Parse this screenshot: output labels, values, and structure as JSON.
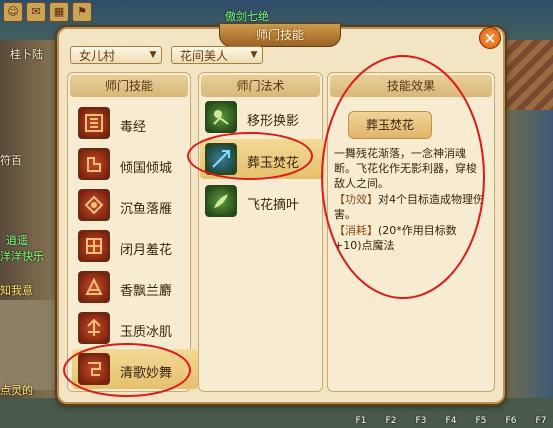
{
  "window": {
    "title": "师门技能",
    "close_label": "×",
    "dropdown_school": "女儿村",
    "dropdown_class": "花间美人"
  },
  "school_skills": {
    "header": "师门技能",
    "items": [
      {
        "label": "毒经",
        "icon": "poison-scripture-icon"
      },
      {
        "label": "倾国倾城",
        "icon": "beauty-icon"
      },
      {
        "label": "沉鱼落雁",
        "icon": "fish-goose-icon"
      },
      {
        "label": "闭月羞花",
        "icon": "moon-flower-icon"
      },
      {
        "label": "香飘兰麝",
        "icon": "fragrance-icon"
      },
      {
        "label": "玉质冰肌",
        "icon": "jade-skin-icon"
      },
      {
        "label": "清歌妙舞",
        "icon": "dance-icon"
      }
    ],
    "selected_index": 6
  },
  "methods": {
    "header": "师门法术",
    "items": [
      {
        "label": "移形换影",
        "icon": "shadow-shift-icon"
      },
      {
        "label": "葬玉焚花",
        "icon": "burning-flower-icon"
      },
      {
        "label": "飞花摘叶",
        "icon": "flying-petal-icon"
      }
    ],
    "selected_index": 1
  },
  "effect": {
    "header": "技能效果",
    "title": "葬玉焚花",
    "description": "一舞残花渐落，一念神消魂断。飞花化作无影利器，穿梭敌人之间。",
    "effect_label": "【功效】",
    "effect_text": "对4个目标造成物理伤害。",
    "cost_label": "【消耗】",
    "cost_text": "(20*作用目标数+10)点魔法"
  },
  "background": {
    "top_text": "傲剑七绝",
    "left_texts": [
      "桂卜陆",
      "符百",
      "知我意",
      "点灵的"
    ],
    "chat_texts": [
      "逍遥",
      "洋洋快乐"
    ],
    "fkeys": [
      "F1",
      "F2",
      "F3",
      "F4",
      "F5",
      "F6",
      "F7",
      "F8"
    ]
  },
  "colors": {
    "accent": "#e0b56a",
    "highlight_circle": "#e01818",
    "panel": "#f7ecd2"
  }
}
